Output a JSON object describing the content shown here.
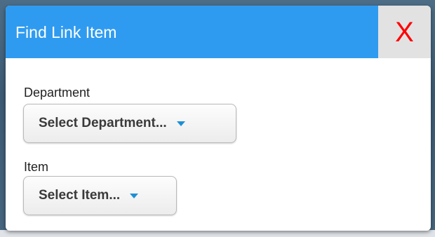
{
  "dialog": {
    "title": "Find Link Item",
    "close_label": "X"
  },
  "department": {
    "label": "Department",
    "selected": "Select Department..."
  },
  "item": {
    "label": "Item",
    "selected": "Select Item..."
  },
  "colors": {
    "header": "#2f9bf0",
    "close_background": "#e2e2e2",
    "close_glyph": "#ff0000",
    "caret": "#1e8fd6"
  },
  "icons": {
    "close": "close-icon",
    "dropdown": "chevron-down-icon"
  }
}
